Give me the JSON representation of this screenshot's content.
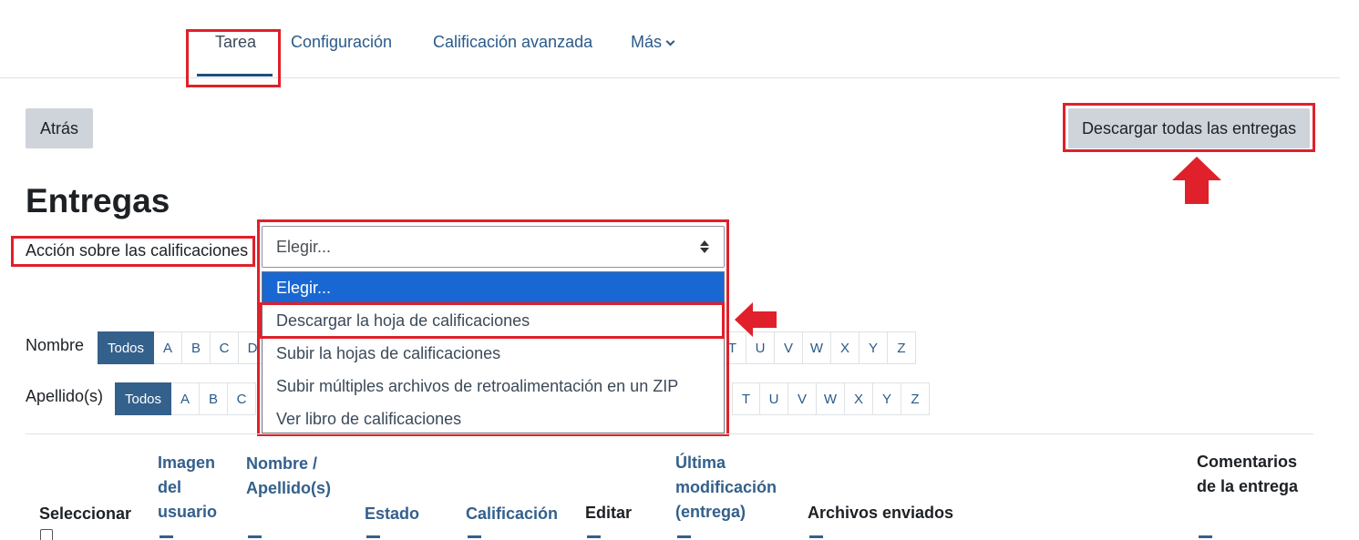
{
  "nav": {
    "tabs": [
      {
        "label": "Tarea",
        "active": true
      },
      {
        "label": "Configuración"
      },
      {
        "label": "Calificación avanzada"
      },
      {
        "label": "Más"
      }
    ]
  },
  "buttons": {
    "back": "Atrás",
    "download_all": "Descargar todas las entregas"
  },
  "page_title": "Entregas",
  "grading_action": {
    "label": "Acción sobre las calificaciones",
    "selected": "Elegir...",
    "options": [
      "Elegir...",
      "Descargar la hoja de calificaciones",
      "Subir la hojas de calificaciones",
      "Subir múltiples archivos de retroalimentación en un ZIP",
      "Ver libro de calificaciones"
    ]
  },
  "filters": {
    "first_name": {
      "label": "Nombre",
      "all": "Todos",
      "letters_left": [
        "A",
        "B",
        "C",
        "D"
      ],
      "letters_right": [
        "T",
        "U",
        "V",
        "W",
        "X",
        "Y",
        "Z"
      ]
    },
    "last_name": {
      "label": "Apellido(s)",
      "all": "Todos",
      "letters_left": [
        "A",
        "B",
        "C"
      ],
      "letters_right": [
        "T",
        "U",
        "V",
        "W",
        "X",
        "Y",
        "Z"
      ]
    }
  },
  "table": {
    "headers": {
      "select": "Seleccionar",
      "user_image": "Imagen del usuario",
      "name": "Nombre / Apellido(s)",
      "status": "Estado",
      "grade": "Calificación",
      "edit": "Editar",
      "last_modified": "Última modificación (entrega)",
      "files": "Archivos enviados",
      "comments": "Comentarios de la entrega"
    }
  },
  "colors": {
    "highlight": "#e0202a",
    "selected_option": "#1967d2",
    "letter_active": "#34608c"
  }
}
